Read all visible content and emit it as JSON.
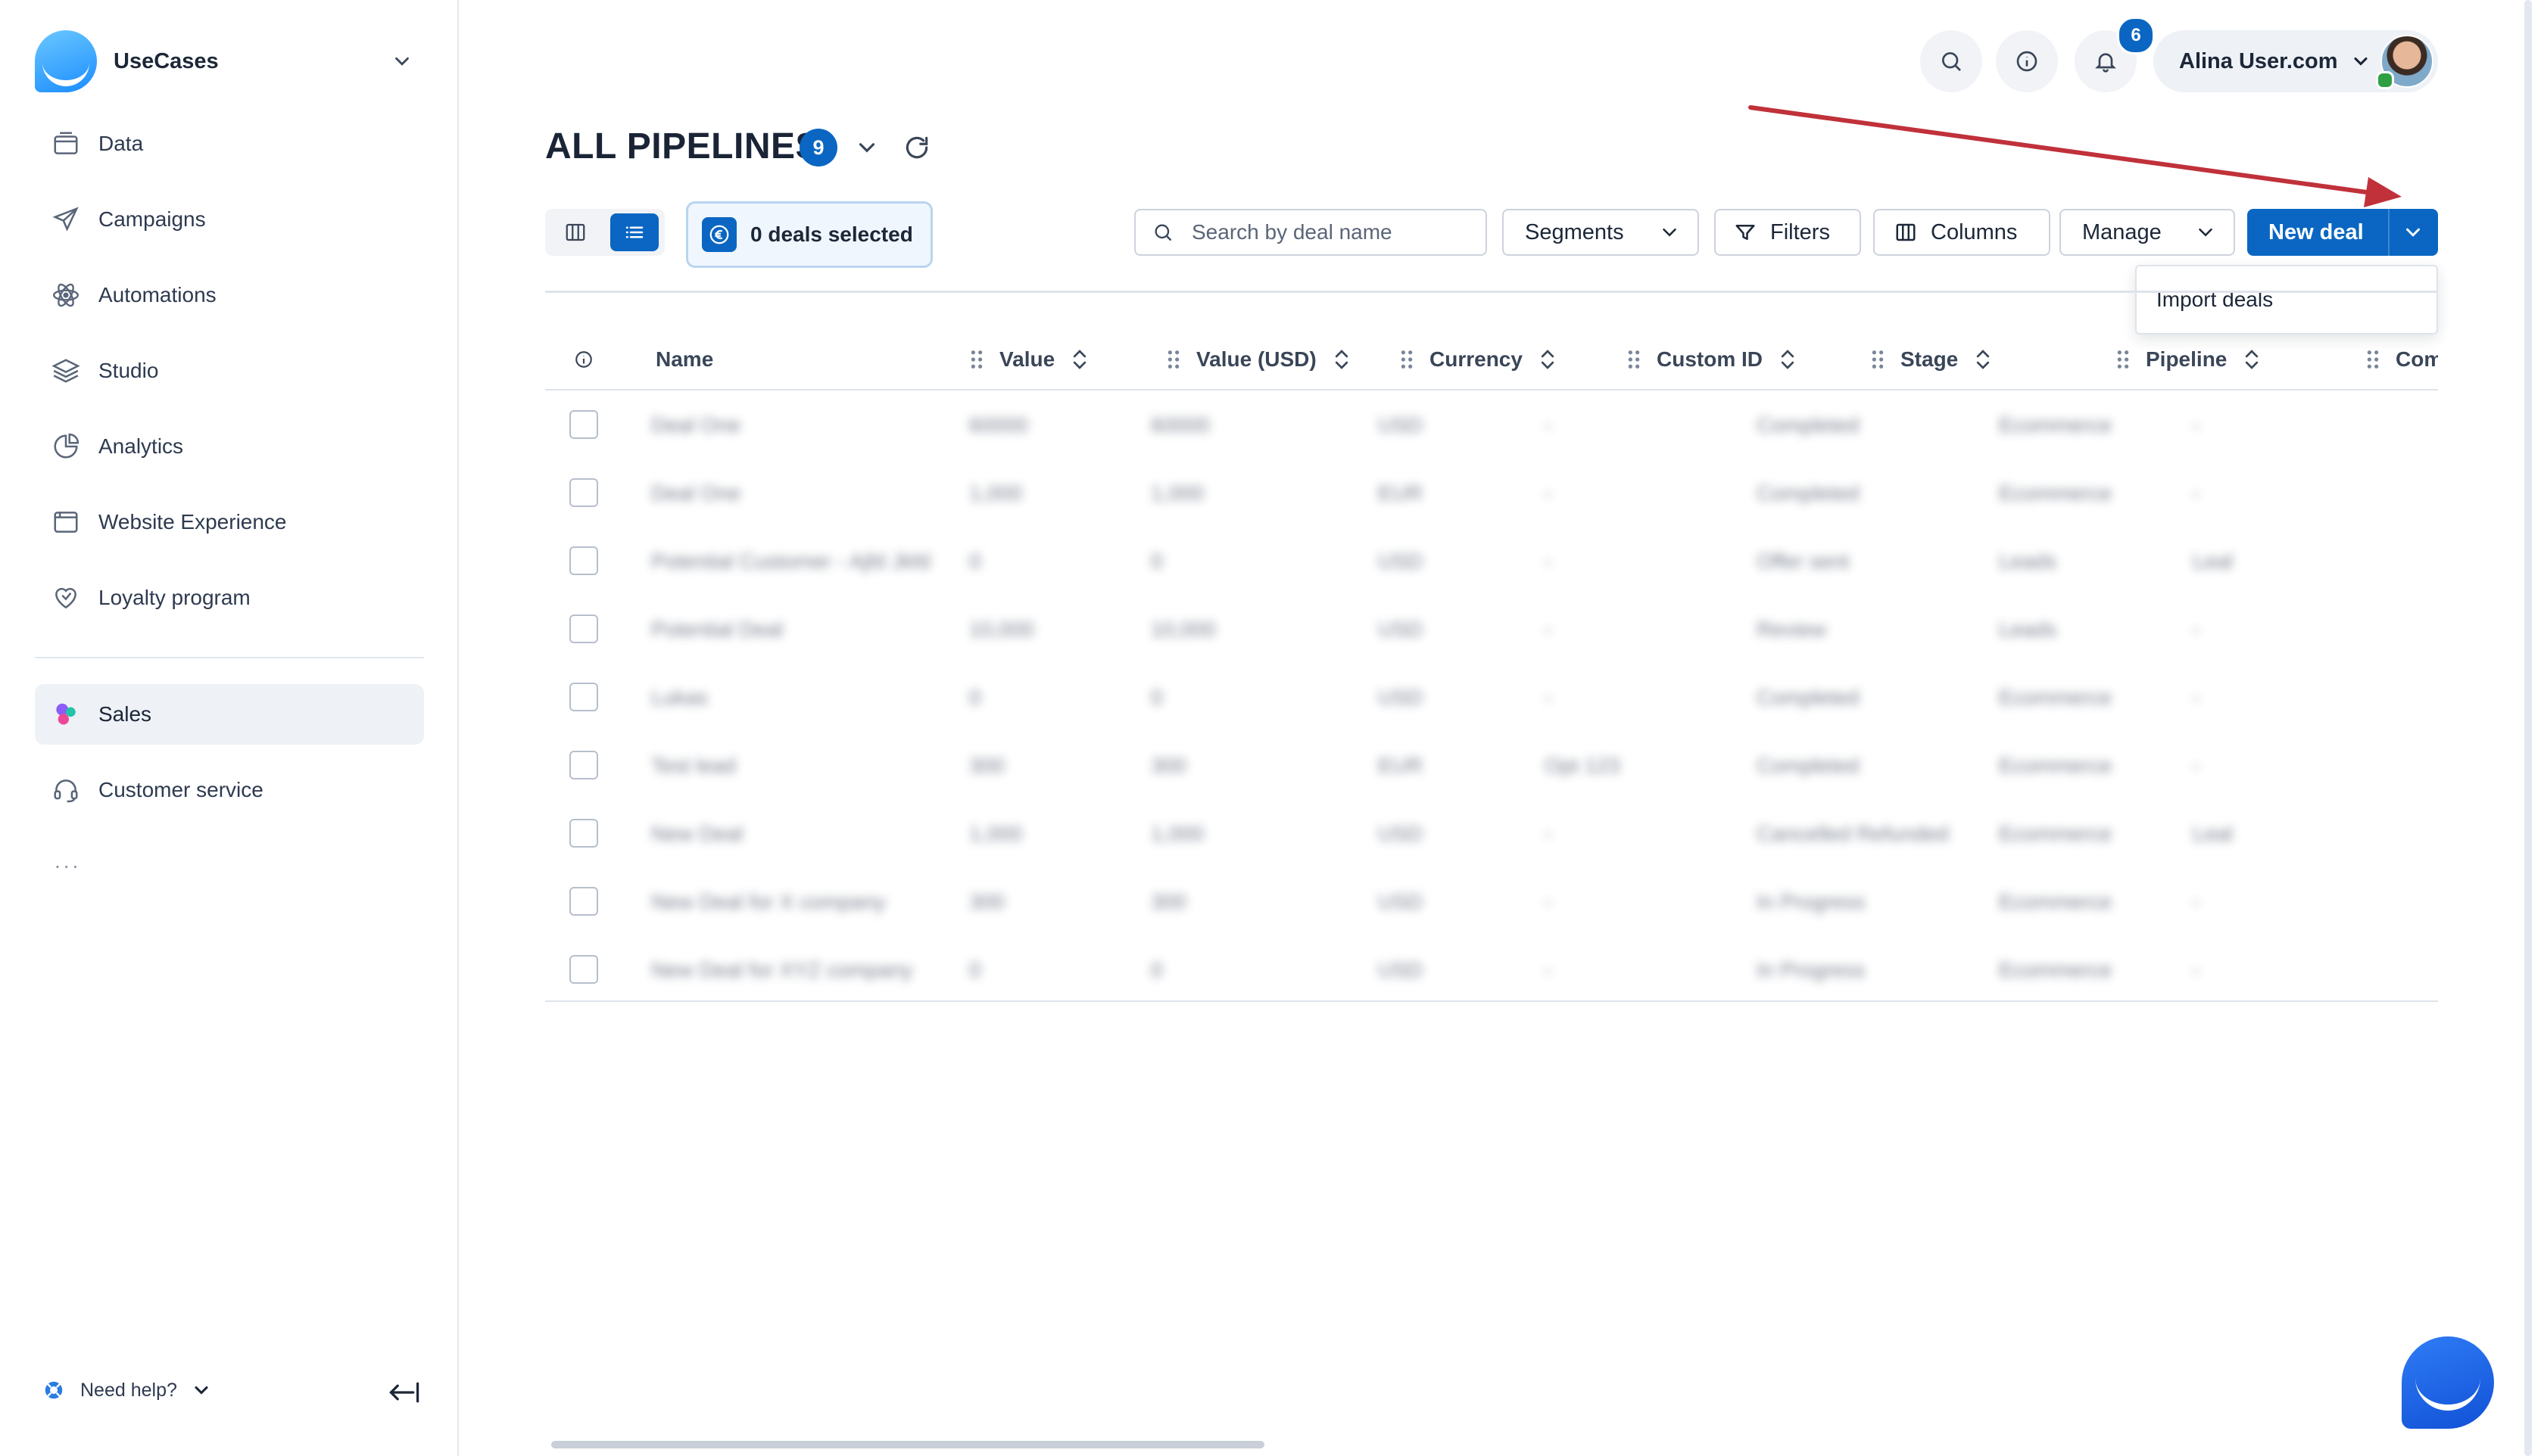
{
  "workspace": {
    "name": "UseCases"
  },
  "sidebar": {
    "items": [
      {
        "label": "Data",
        "icon": "database-icon"
      },
      {
        "label": "Campaigns",
        "icon": "paper-plane-icon"
      },
      {
        "label": "Automations",
        "icon": "atom-icon"
      },
      {
        "label": "Studio",
        "icon": "layers-icon"
      },
      {
        "label": "Analytics",
        "icon": "pie-chart-icon"
      },
      {
        "label": "Website Experience",
        "icon": "browser-window-icon"
      },
      {
        "label": "Loyalty program",
        "icon": "heart-badge-icon"
      }
    ],
    "items2": [
      {
        "label": "Sales",
        "icon": "sales-dots-icon",
        "active": true
      },
      {
        "label": "Customer service",
        "icon": "headset-icon"
      }
    ],
    "more": "...",
    "help": "Need help?"
  },
  "topbar": {
    "notification_count": "6",
    "user_name": "Alina User.com"
  },
  "header": {
    "title": "ALL PIPELINES",
    "count": "9",
    "deals_selected": "0 deals selected"
  },
  "toolbar": {
    "search_placeholder": "Search by deal name",
    "segments": "Segments",
    "filters": "Filters",
    "columns": "Columns",
    "manage": "Manage",
    "new_deal": "New deal",
    "dropdown_item": "Import deals"
  },
  "table": {
    "columns": [
      "Name",
      "Value",
      "Value (USD)",
      "Currency",
      "Custom ID",
      "Stage",
      "Pipeline",
      "Comp"
    ],
    "rows": [
      [
        "Deal One",
        "60000",
        "60000",
        "USD",
        "-",
        "Completed",
        "Ecommerce",
        "-"
      ],
      [
        "Deal One",
        "1,000",
        "1,000",
        "EUR",
        "-",
        "Completed",
        "Ecommerce",
        "-"
      ],
      [
        "Potential Customer - Ajfd Jkfd",
        "0",
        "0",
        "USD",
        "-",
        "Offer sent",
        "Leads",
        "Leal"
      ],
      [
        "Potential Deal",
        "10,000",
        "10,000",
        "USD",
        "-",
        "Review",
        "Leads",
        "-"
      ],
      [
        "Lukas",
        "0",
        "0",
        "USD",
        "-",
        "Completed",
        "Ecommerce",
        "-"
      ],
      [
        "Test lead",
        "300",
        "300",
        "EUR",
        "Opt 123",
        "Completed",
        "Ecommerce",
        "-"
      ],
      [
        "New Deal",
        "1,000",
        "1,000",
        "USD",
        "-",
        "Cancelled Refunded",
        "Ecommerce",
        "Leal"
      ],
      [
        "New Deal for X company",
        "300",
        "300",
        "USD",
        "-",
        "In Progress",
        "Ecommerce",
        "-"
      ],
      [
        "New Deal for XYZ company",
        "0",
        "0",
        "USD",
        "-",
        "In Progress",
        "Ecommerce",
        "-"
      ]
    ]
  },
  "colors": {
    "accent": "#0a66c2",
    "arrow": "#c0313a"
  }
}
